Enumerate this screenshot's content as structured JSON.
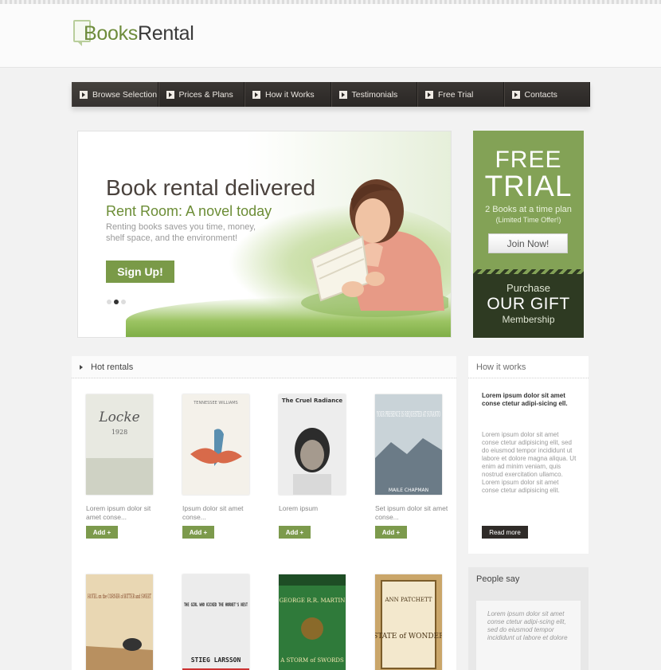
{
  "logo": {
    "part1": "Books",
    "part2": "Rental"
  },
  "nav": {
    "items": [
      "Browse Selection",
      "Prices & Plans",
      "How it Works",
      "Testimonials",
      "Free Trial",
      "Contacts"
    ]
  },
  "hero": {
    "title": "Book rental delivered",
    "subtitle": "Rent Room: A novel today",
    "text": "Renting books saves you time, money, shelf space, and the environment!",
    "button": "Sign Up!"
  },
  "trial": {
    "line_free": "FREE",
    "line_trial": "TRIAL",
    "plan": "2 Books at a time plan",
    "offer": "(Limited Time Offer!)",
    "button": "Join Now!"
  },
  "gift": {
    "line1": "Purchase",
    "line2": "OUR GIFT",
    "line3": "Membership"
  },
  "hot": {
    "title": "Hot rentals",
    "add_label": "Add",
    "books": [
      {
        "caption": "Lorem ipsum dolor sit amet conse...",
        "cover_title": "Locke",
        "cover_sub": "1928"
      },
      {
        "caption": "Ipsum dolor sit amet conse...",
        "cover_title": "TENNESSEE WILLIAMS",
        "cover_sub": ""
      },
      {
        "caption": "Lorem ipsum",
        "cover_title": "The Cruel Radiance",
        "cover_sub": ""
      },
      {
        "caption": "Set ipsum dolor sit amet conse...",
        "cover_title": "YOUR PRESENCE IS REQUESTED AT SUVANTO",
        "cover_sub": "MAILE CHAPMAN"
      },
      {
        "caption": "",
        "cover_title": "HOTEL on the CORNER of BITTER and SWEET",
        "cover_sub": ""
      },
      {
        "caption": "",
        "cover_title": "THE GIRL WHO KICKED THE HORNET'S NEST",
        "cover_sub": "STIEG LARSSON"
      },
      {
        "caption": "",
        "cover_title": "GEORGE R.R. MARTIN",
        "cover_sub": "A STORM of SWORDS"
      },
      {
        "caption": "",
        "cover_title": "ANN PATCHETT",
        "cover_sub": "STATE of WONDER"
      }
    ]
  },
  "how": {
    "title": "How it works",
    "bold": "Lorem ipsum dolor sit amet conse ctetur adipi-sicing ell.",
    "body": "Lorem ipsum dolor sit amet conse ctetur adipisicing elit, sed do eiusmod tempor incididunt ut labore et dolore magna aliqua. Ut enim ad minim veniam, quis nostrud exercitation ullamco. Lorem ipsum dolor sit amet conse ctetur adipisicing elit.",
    "button": "Read more"
  },
  "people": {
    "title": "People say",
    "quote": "Lorem ipsum dolor sit amet conse ctetur adipi-scing elit, sed do eiusmod tempor incididunt ut labore et dolore"
  }
}
